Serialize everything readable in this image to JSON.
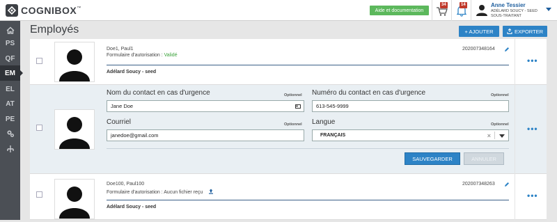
{
  "brand": {
    "name": "COGNIBOX",
    "tm": "™"
  },
  "topbar": {
    "help_label": "Aide et documentation",
    "cart_badge": "34",
    "bell_badge": "14",
    "user_name": "Anne Tessier",
    "user_org_line1": "ADÉLARD SOUCY - SEED",
    "user_org_line2": "SOUS-TRAITANT"
  },
  "sidebar": {
    "items": [
      {
        "label": "",
        "icon": "home-icon"
      },
      {
        "label": "PS"
      },
      {
        "label": "QF"
      },
      {
        "label": "EM",
        "active": true
      },
      {
        "label": "EL"
      },
      {
        "label": "AT"
      },
      {
        "label": "PE"
      },
      {
        "label": "",
        "icon": "gears-icon"
      },
      {
        "label": "",
        "icon": "hierarchy-icon"
      }
    ]
  },
  "page": {
    "title": "Employés",
    "add_label": "+ AJOUTER",
    "export_label": "EXPORTER"
  },
  "employees": [
    {
      "name": "Doe1, Paul1",
      "auth_label": "Formulaire d'autorisation : ",
      "auth_value": "Validé",
      "id": "202007348164",
      "org": "Adélard Soucy - seed"
    },
    {
      "name": "Doe100, Paul100",
      "auth_label": "Formulaire d'autorisation : ",
      "auth_value": "Aucun fichier reçu",
      "id": "202007348263",
      "org": "Adélard Soucy - seed"
    }
  ],
  "form": {
    "emergency_contact_label": "Nom du contact en cas d'urgence",
    "emergency_contact_optional": "Optionnel",
    "emergency_contact_value": "Jane Doe",
    "emergency_phone_label": "Numéro du contact en cas d'urgence",
    "emergency_phone_optional": "Optionnel",
    "emergency_phone_value": "613-545-9999",
    "email_label": "Courriel",
    "email_optional": "Optionnel",
    "email_value": "janedoe@gmail.com",
    "language_label": "Langue",
    "language_optional": "Optionnel",
    "language_value": "FRANÇAIS",
    "clear_symbol": "×",
    "save_label": "SAUVEGARDER",
    "cancel_label": "ANNULER"
  },
  "more_symbol": "•••"
}
